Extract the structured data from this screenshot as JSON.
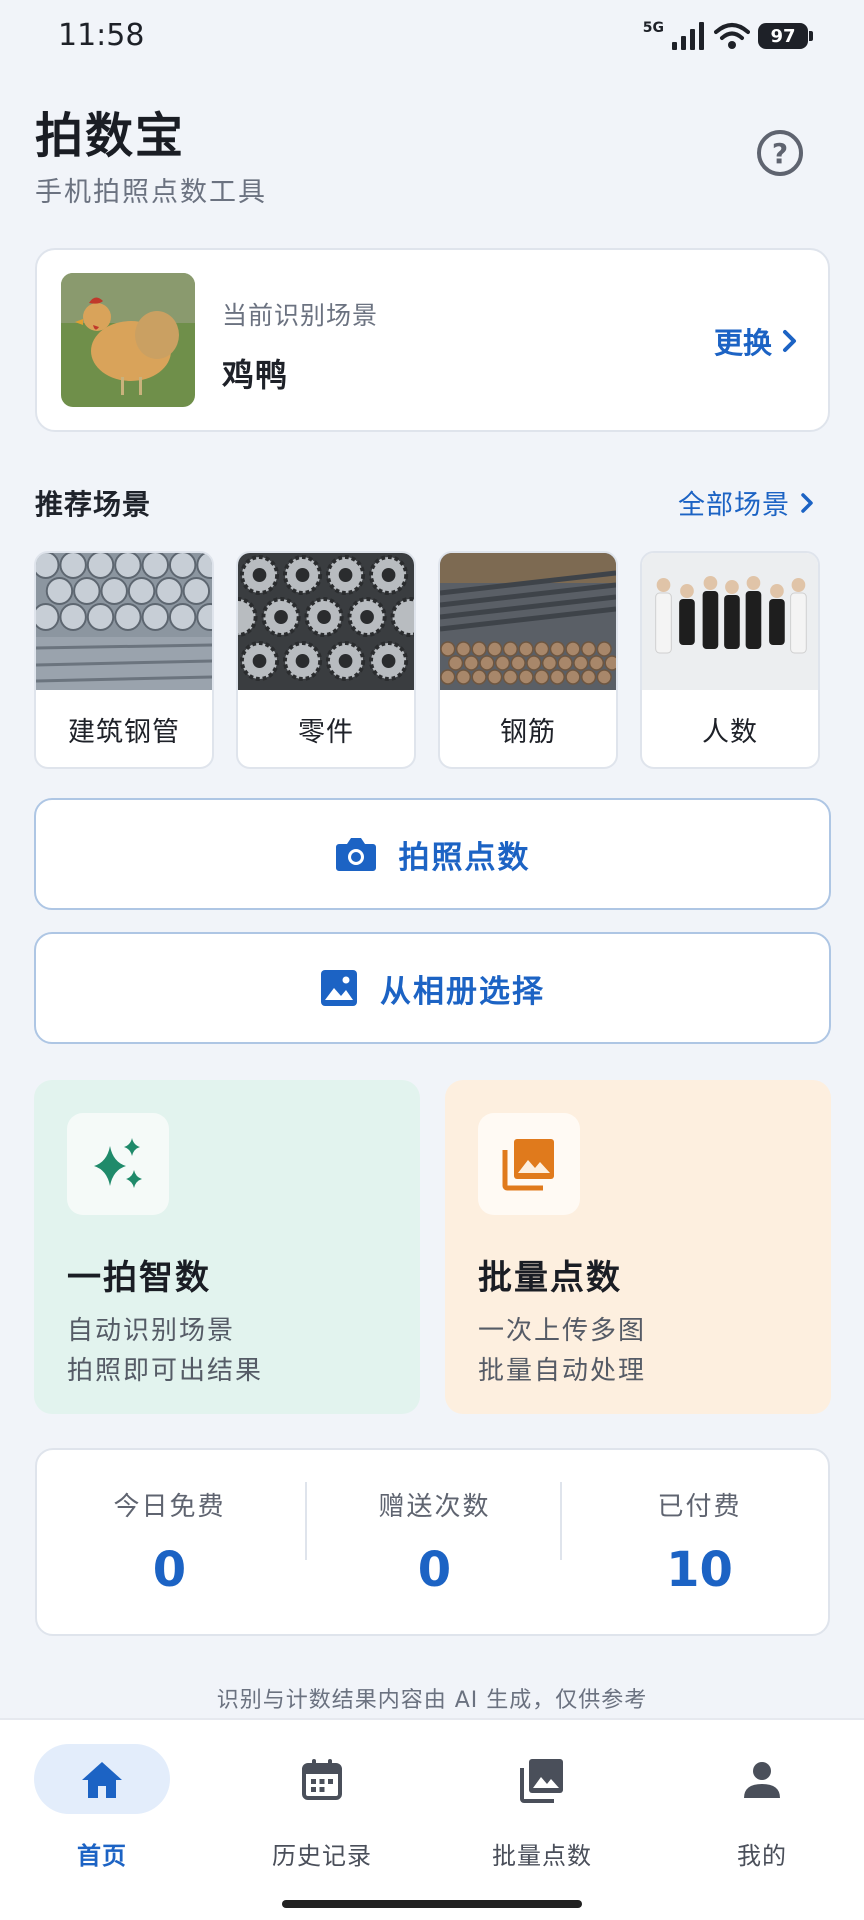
{
  "status_bar": {
    "time": "11:58",
    "network": "5G",
    "battery": "97"
  },
  "header": {
    "title": "拍数宝",
    "subtitle": "手机拍照点数工具",
    "help_icon": "help-circle-icon"
  },
  "current_scene": {
    "label": "当前识别场景",
    "name": "鸡鸭",
    "change_label": "更换"
  },
  "recommended": {
    "title": "推荐场景",
    "all_label": "全部场景",
    "items": [
      {
        "label": "建筑钢管",
        "icon": "steel-pipes-image"
      },
      {
        "label": "零件",
        "icon": "gear-parts-image"
      },
      {
        "label": "钢筋",
        "icon": "rebar-image"
      },
      {
        "label": "人数",
        "icon": "people-group-image"
      }
    ]
  },
  "actions": {
    "photo_count": {
      "label": "拍照点数",
      "icon": "camera-icon"
    },
    "from_album": {
      "label": "从相册选择",
      "icon": "image-icon"
    }
  },
  "features": [
    {
      "title": "一拍智数",
      "desc_line1": "自动识别场景",
      "desc_line2": "拍照即可出结果",
      "icon": "sparkles-icon",
      "accent": "#1f8a6a"
    },
    {
      "title": "批量点数",
      "desc_line1": "一次上传多图",
      "desc_line2": "批量自动处理",
      "icon": "photo-library-icon",
      "accent": "#e07a1c"
    }
  ],
  "stats": [
    {
      "label": "今日免费",
      "value": "0"
    },
    {
      "label": "赠送次数",
      "value": "0"
    },
    {
      "label": "已付费",
      "value": "10"
    }
  ],
  "disclaimer": "识别与计数结果内容由 AI 生成，仅供参考",
  "nav": [
    {
      "label": "首页",
      "icon": "home-icon",
      "active": true
    },
    {
      "label": "历史记录",
      "icon": "calendar-icon",
      "active": false
    },
    {
      "label": "批量点数",
      "icon": "photo-library-icon",
      "active": false
    },
    {
      "label": "我的",
      "icon": "person-icon",
      "active": false
    }
  ],
  "colors": {
    "primary": "#1c63c4",
    "background": "#f1f4f9",
    "feature_green_bg": "#e2f3ee",
    "feature_orange_bg": "#fdefdf"
  }
}
